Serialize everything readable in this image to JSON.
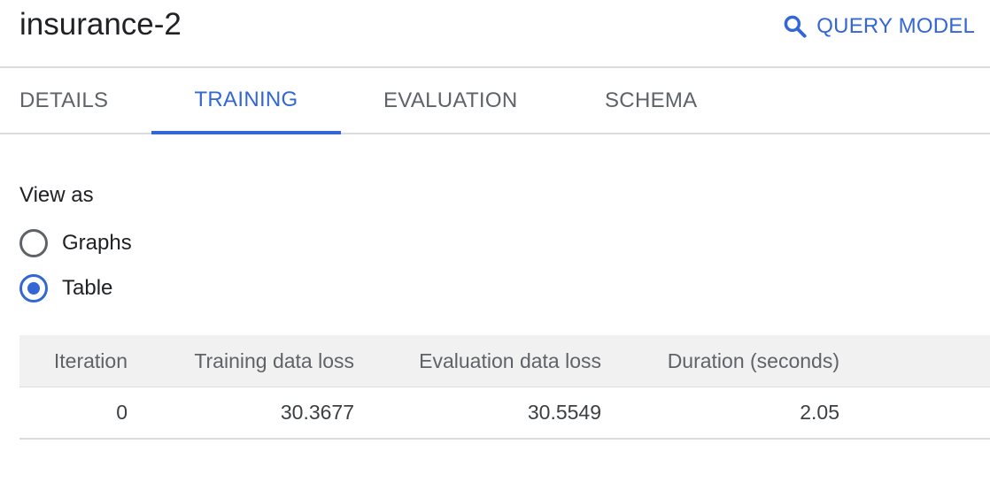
{
  "header": {
    "title": "insurance-2",
    "query_button": {
      "label": "QUERY MODEL",
      "icon": "search-icon"
    }
  },
  "tabs": [
    {
      "label": "DETAILS",
      "active": false
    },
    {
      "label": "TRAINING",
      "active": true
    },
    {
      "label": "EVALUATION",
      "active": false
    },
    {
      "label": "SCHEMA",
      "active": false
    }
  ],
  "view_as": {
    "heading": "View as",
    "options": [
      {
        "label": "Graphs",
        "checked": false
      },
      {
        "label": "Table",
        "checked": true
      }
    ]
  },
  "table": {
    "columns": [
      "Iteration",
      "Training data loss",
      "Evaluation data loss",
      "Duration (seconds)"
    ],
    "rows": [
      [
        "0",
        "30.3677",
        "30.5549",
        "2.05"
      ]
    ]
  },
  "colors": {
    "accent": "#3367d6",
    "divider": "#dadce0",
    "table_header_bg": "#f1f1f1"
  }
}
